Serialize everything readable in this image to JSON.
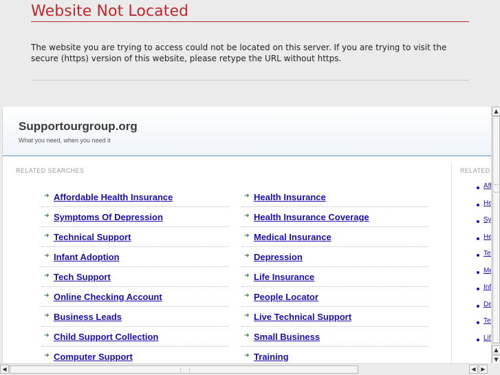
{
  "error": {
    "title": "Website Not Located",
    "message": "The website you are trying to access could not be located on this server. If you are trying to visit the secure (https) version of this website, please retype the URL without https."
  },
  "site": {
    "title": "Supportourgroup.org",
    "tagline": "What you need, when you need it"
  },
  "related": {
    "heading": "RELATED SEARCHES",
    "left": [
      "Affordable Health Insurance",
      "Symptoms Of Depression",
      "Technical Support",
      "Infant Adoption",
      "Tech Support",
      "Online Checking Account",
      "Business Leads",
      "Child Support Collection",
      "Computer Support"
    ],
    "right": [
      "Health Insurance",
      "Health Insurance Coverage",
      "Medical Insurance",
      "Depression",
      "Life Insurance",
      "People Locator",
      "Live Technical Support",
      "Small Business",
      "Training"
    ]
  },
  "sidebar": {
    "heading": "RELATED",
    "items": [
      "Affo",
      "He",
      "Sy",
      "He",
      "Tec",
      "Me",
      "Infa",
      "De",
      "Tec",
      "Life"
    ]
  },
  "icons": {
    "list_arrow": "right-arrow-icon",
    "scroll_up": "scroll-up-icon",
    "scroll_down": "scroll-down-icon",
    "scroll_left": "scroll-left-icon",
    "scroll_right": "scroll-right-icon"
  },
  "colors": {
    "error_red": "#c1272d",
    "link_blue": "#1a0dab",
    "header_rule": "#5b8fc5"
  }
}
